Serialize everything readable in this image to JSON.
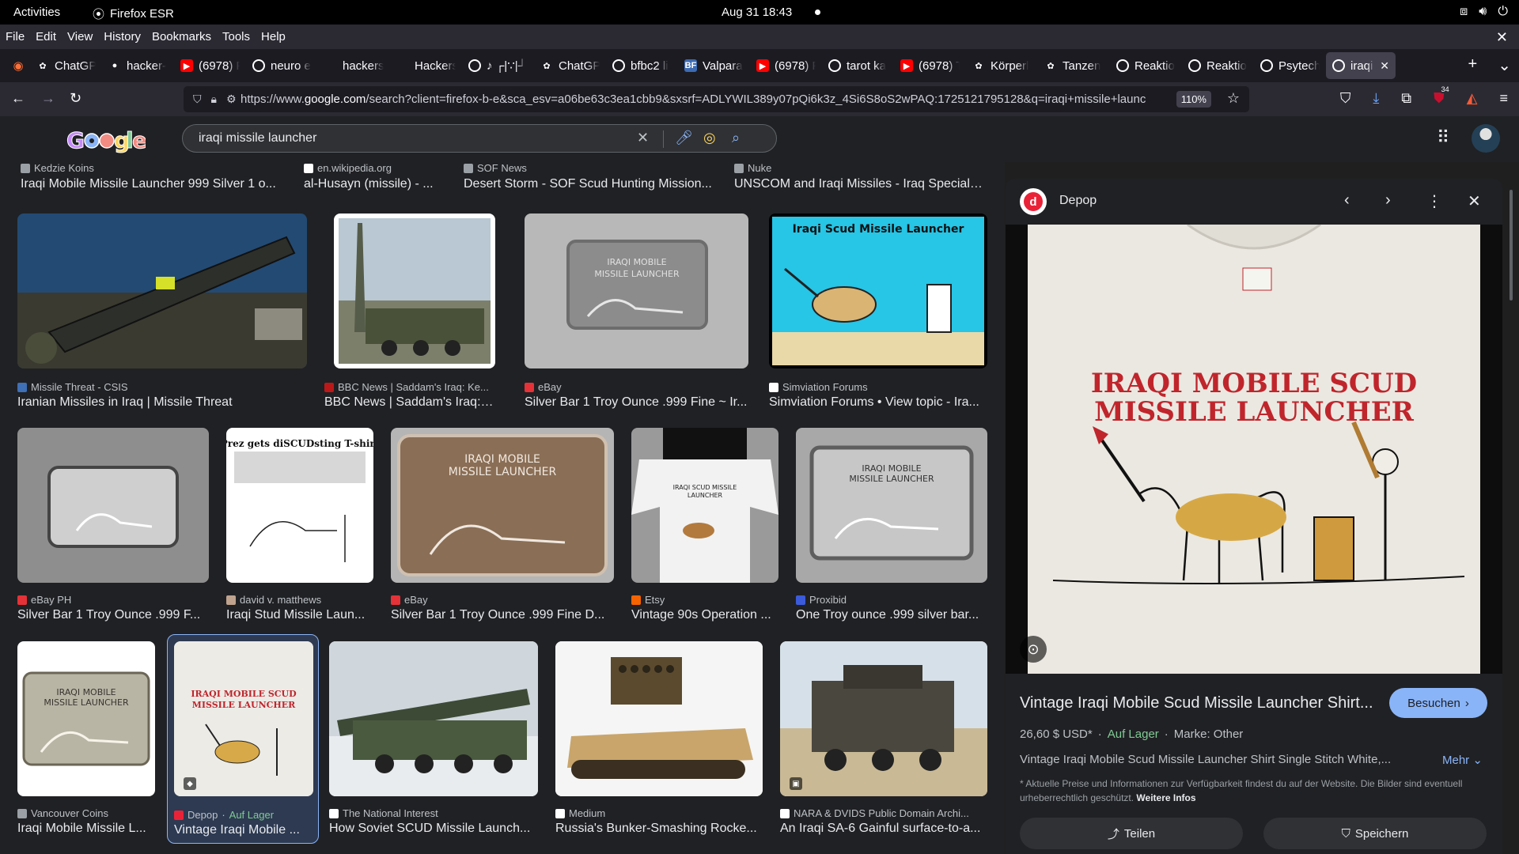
{
  "system": {
    "activities": "Activities",
    "app_name": "Firefox ESR",
    "clock": "Aug 31  18:43"
  },
  "menubar": [
    "File",
    "Edit",
    "View",
    "History",
    "Bookmarks",
    "Tools",
    "Help"
  ],
  "tabs": [
    {
      "title": "ChatGP",
      "icon": "openai-icon",
      "color": "#ffffff"
    },
    {
      "title": "hacker-",
      "icon": "github-icon",
      "color": "#ffffff"
    },
    {
      "title": "(6978) F",
      "icon": "youtube-icon",
      "color": "#ff0000"
    },
    {
      "title": "neuro e",
      "icon": "google-icon",
      "color": "#ffffff"
    },
    {
      "title": "hackerscar",
      "icon": "none",
      "color": "#42414d"
    },
    {
      "title": "HackersCar",
      "icon": "none",
      "color": "#42414d"
    },
    {
      "title": "♪ ┌|∵|┘ ♪",
      "icon": "google-icon",
      "color": "#ffffff"
    },
    {
      "title": "ChatGP",
      "icon": "openai-icon",
      "color": "#ffffff"
    },
    {
      "title": "bfbc2 li",
      "icon": "google-icon",
      "color": "#ffffff"
    },
    {
      "title": "Valpara",
      "icon": "bf-icon",
      "color": "#3d6bb3"
    },
    {
      "title": "(6978) F",
      "icon": "youtube-icon",
      "color": "#ff0000"
    },
    {
      "title": "tarot ka",
      "icon": "google-icon",
      "color": "#ffffff"
    },
    {
      "title": "(6978) T",
      "icon": "youtube-icon",
      "color": "#ff0000"
    },
    {
      "title": "Körperl",
      "icon": "openai-icon",
      "color": "#ffffff"
    },
    {
      "title": "Tanzen",
      "icon": "openai-icon",
      "color": "#ffffff"
    },
    {
      "title": "Reaktio",
      "icon": "google-icon",
      "color": "#ffffff"
    },
    {
      "title": "Reaktio",
      "icon": "google-icon",
      "color": "#ffffff"
    },
    {
      "title": "Psytech",
      "icon": "google-icon",
      "color": "#ffffff"
    },
    {
      "title": "iraqi r",
      "icon": "google-icon",
      "color": "#ffffff"
    }
  ],
  "url": {
    "prefix": "https://www.",
    "domain": "google.com",
    "rest": "/search?client=firefox-b-e&sca_esv=a06be63c3ea1cbb9&sxsrf=ADLYWIL389y07pQi6k3z_4Si6S8oS2wPAQ:1725121795128&q=iraqi+missile+launc",
    "zoom": "110%",
    "badge": "34"
  },
  "search": {
    "query": "iraqi missile launcher"
  },
  "results_top": [
    {
      "source": "Kedzie Koins",
      "title": "Iraqi Mobile Missile Launcher 999 Silver 1 o..."
    },
    {
      "source": "en.wikipedia.org",
      "title": "al-Husayn (missile) - ..."
    },
    {
      "source": "SOF News",
      "title": "Desert Storm - SOF Scud Hunting Mission..."
    },
    {
      "source": "Nuke",
      "title": "UNSCOM and Iraqi Missiles - Iraq Special ..."
    }
  ],
  "results_row1": [
    {
      "source": "Missile Threat - CSIS",
      "title": "Iranian Missiles in Iraq | Missile Threat"
    },
    {
      "source": "BBC News | Saddam's Iraq: Ke...",
      "title": "BBC News | Saddam's Iraq: ..."
    },
    {
      "source": "eBay",
      "title": "Silver Bar 1 Troy Ounce .999 Fine ~ Ir..."
    },
    {
      "source": "Simviation Forums",
      "title": "Simviation Forums • View topic - Ira...",
      "caption": "Iraqi Scud Missile Launcher"
    }
  ],
  "results_row2": [
    {
      "source": "eBay PH",
      "title": "Silver Bar 1 Troy Ounce .999 F..."
    },
    {
      "source": "david v. matthews",
      "title": "Iraqi Stud Missile Laun...",
      "caption": "Prez gets diSCUDsting T-shirt"
    },
    {
      "source": "eBay",
      "title": "Silver Bar 1 Troy Ounce .999 Fine D..."
    },
    {
      "source": "Etsy",
      "title": "Vintage 90s Operation ..."
    },
    {
      "source": "Proxibid",
      "title": "One Troy ounce .999 silver bar..."
    }
  ],
  "results_row3": [
    {
      "source": "Vancouver Coins",
      "title": "Iraqi Mobile Missile L..."
    },
    {
      "source": "Depop",
      "stock": "Auf Lager",
      "title": "Vintage Iraqi Mobile ..."
    },
    {
      "source": "The National Interest",
      "title": "How Soviet SCUD Missile Launch..."
    },
    {
      "source": "Medium",
      "title": "Russia's Bunker-Smashing Rocke..."
    },
    {
      "source": "NARA & DVIDS Public Domain Archi...",
      "title": "An Iraqi SA-6 Gainful surface-to-a..."
    }
  ],
  "bar_text": {
    "line1": "IRAQI MOBILE",
    "line2": "MISSILE LAUNCHER"
  },
  "preview": {
    "source": "Depop",
    "shirt_line1": "IRAQI MOBILE SCUD",
    "shirt_line2": "MISSILE LAUNCHER",
    "title": "Vintage Iraqi Mobile Scud Missile Launcher Shirt...",
    "visit_label": "Besuchen",
    "price": "26,60 $ USD*",
    "stock": "Auf Lager",
    "brand": "Marke: Other",
    "description": "Vintage Iraqi Mobile Scud Missile Launcher Shirt Single Stitch White,...",
    "more_label": "Mehr",
    "disclaimer": "* Aktuelle Preise und Informationen zur Verfügbarkeit findest du auf der Website. Die Bilder sind eventuell urheberrechtlich geschützt.",
    "disclaimer_link": "Weitere Infos",
    "share_label": "Teilen",
    "save_label": "Speichern"
  },
  "colors": {
    "page_bg": "#202124",
    "accent": "#8ab4f8",
    "stock_green": "#81c995",
    "depop_red": "#ea2238"
  }
}
